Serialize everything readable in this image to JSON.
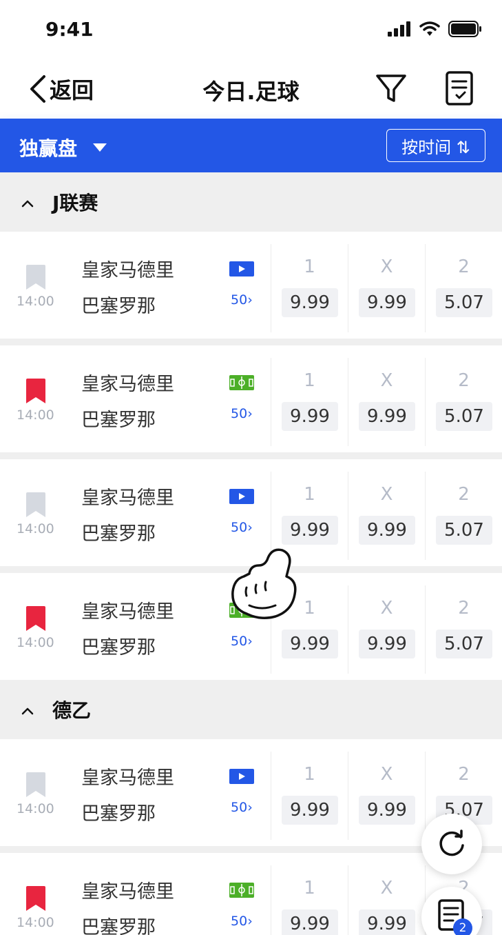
{
  "status_bar": {
    "time": "9:41"
  },
  "nav": {
    "back_label": "返回",
    "title": "今日.足球"
  },
  "toolbar": {
    "market_label": "独赢盘",
    "sort_label": "按时间 ⇅"
  },
  "leagues": [
    {
      "name": "J联赛"
    },
    {
      "name": "德乙"
    }
  ],
  "matches": [
    {
      "time": "14:00",
      "home": "皇家马德里",
      "away": "巴塞罗那",
      "more": "50",
      "fav": false,
      "media": "live-video",
      "odds": [
        {
          "label": "1",
          "value": "9.99"
        },
        {
          "label": "X",
          "value": "9.99"
        },
        {
          "label": "2",
          "value": "5.07"
        }
      ]
    },
    {
      "time": "14:00",
      "home": "皇家马德里",
      "away": "巴塞罗那",
      "more": "50",
      "fav": true,
      "media": "pitch",
      "odds": [
        {
          "label": "1",
          "value": "9.99"
        },
        {
          "label": "X",
          "value": "9.99"
        },
        {
          "label": "2",
          "value": "5.07"
        }
      ]
    },
    {
      "time": "14:00",
      "home": "皇家马德里",
      "away": "巴塞罗那",
      "more": "50",
      "fav": false,
      "media": "live-video",
      "odds": [
        {
          "label": "1",
          "value": "9.99"
        },
        {
          "label": "X",
          "value": "9.99"
        },
        {
          "label": "2",
          "value": "5.07"
        }
      ]
    },
    {
      "time": "14:00",
      "home": "皇家马德里",
      "away": "巴塞罗那",
      "more": "50",
      "fav": true,
      "media": "pitch",
      "odds": [
        {
          "label": "1",
          "value": "9.99"
        },
        {
          "label": "X",
          "value": "9.99"
        },
        {
          "label": "2",
          "value": "5.07"
        }
      ]
    },
    {
      "time": "14:00",
      "home": "皇家马德里",
      "away": "巴塞罗那",
      "more": "50",
      "fav": false,
      "media": "live-video",
      "odds": [
        {
          "label": "1",
          "value": "9.99"
        },
        {
          "label": "X",
          "value": "9.99"
        },
        {
          "label": "2",
          "value": "5.07"
        }
      ]
    },
    {
      "time": "14:00",
      "home": "皇家马德里",
      "away": "巴塞罗那",
      "more": "50",
      "fav": true,
      "media": "pitch",
      "odds": [
        {
          "label": "1",
          "value": "9.99"
        },
        {
          "label": "X",
          "value": "9.99"
        },
        {
          "label": "2",
          "value": "5.07"
        }
      ]
    }
  ],
  "fab": {
    "betslip_count": "2"
  },
  "colors": {
    "primary": "#2357e6",
    "fav_active": "#e8253f",
    "fav_inactive": "#d5d9e0",
    "pitch": "#4caf28"
  }
}
